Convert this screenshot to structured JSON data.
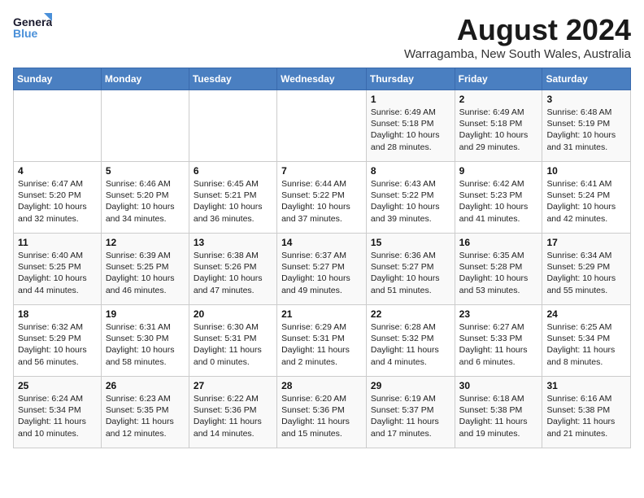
{
  "header": {
    "logo_line1": "General",
    "logo_line2": "Blue",
    "month_year": "August 2024",
    "location": "Warragamba, New South Wales, Australia"
  },
  "days_of_week": [
    "Sunday",
    "Monday",
    "Tuesday",
    "Wednesday",
    "Thursday",
    "Friday",
    "Saturday"
  ],
  "weeks": [
    [
      {
        "day": "",
        "info": ""
      },
      {
        "day": "",
        "info": ""
      },
      {
        "day": "",
        "info": ""
      },
      {
        "day": "",
        "info": ""
      },
      {
        "day": "1",
        "info": "Sunrise: 6:49 AM\nSunset: 5:18 PM\nDaylight: 10 hours\nand 28 minutes."
      },
      {
        "day": "2",
        "info": "Sunrise: 6:49 AM\nSunset: 5:18 PM\nDaylight: 10 hours\nand 29 minutes."
      },
      {
        "day": "3",
        "info": "Sunrise: 6:48 AM\nSunset: 5:19 PM\nDaylight: 10 hours\nand 31 minutes."
      }
    ],
    [
      {
        "day": "4",
        "info": "Sunrise: 6:47 AM\nSunset: 5:20 PM\nDaylight: 10 hours\nand 32 minutes."
      },
      {
        "day": "5",
        "info": "Sunrise: 6:46 AM\nSunset: 5:20 PM\nDaylight: 10 hours\nand 34 minutes."
      },
      {
        "day": "6",
        "info": "Sunrise: 6:45 AM\nSunset: 5:21 PM\nDaylight: 10 hours\nand 36 minutes."
      },
      {
        "day": "7",
        "info": "Sunrise: 6:44 AM\nSunset: 5:22 PM\nDaylight: 10 hours\nand 37 minutes."
      },
      {
        "day": "8",
        "info": "Sunrise: 6:43 AM\nSunset: 5:22 PM\nDaylight: 10 hours\nand 39 minutes."
      },
      {
        "day": "9",
        "info": "Sunrise: 6:42 AM\nSunset: 5:23 PM\nDaylight: 10 hours\nand 41 minutes."
      },
      {
        "day": "10",
        "info": "Sunrise: 6:41 AM\nSunset: 5:24 PM\nDaylight: 10 hours\nand 42 minutes."
      }
    ],
    [
      {
        "day": "11",
        "info": "Sunrise: 6:40 AM\nSunset: 5:25 PM\nDaylight: 10 hours\nand 44 minutes."
      },
      {
        "day": "12",
        "info": "Sunrise: 6:39 AM\nSunset: 5:25 PM\nDaylight: 10 hours\nand 46 minutes."
      },
      {
        "day": "13",
        "info": "Sunrise: 6:38 AM\nSunset: 5:26 PM\nDaylight: 10 hours\nand 47 minutes."
      },
      {
        "day": "14",
        "info": "Sunrise: 6:37 AM\nSunset: 5:27 PM\nDaylight: 10 hours\nand 49 minutes."
      },
      {
        "day": "15",
        "info": "Sunrise: 6:36 AM\nSunset: 5:27 PM\nDaylight: 10 hours\nand 51 minutes."
      },
      {
        "day": "16",
        "info": "Sunrise: 6:35 AM\nSunset: 5:28 PM\nDaylight: 10 hours\nand 53 minutes."
      },
      {
        "day": "17",
        "info": "Sunrise: 6:34 AM\nSunset: 5:29 PM\nDaylight: 10 hours\nand 55 minutes."
      }
    ],
    [
      {
        "day": "18",
        "info": "Sunrise: 6:32 AM\nSunset: 5:29 PM\nDaylight: 10 hours\nand 56 minutes."
      },
      {
        "day": "19",
        "info": "Sunrise: 6:31 AM\nSunset: 5:30 PM\nDaylight: 10 hours\nand 58 minutes."
      },
      {
        "day": "20",
        "info": "Sunrise: 6:30 AM\nSunset: 5:31 PM\nDaylight: 11 hours\nand 0 minutes."
      },
      {
        "day": "21",
        "info": "Sunrise: 6:29 AM\nSunset: 5:31 PM\nDaylight: 11 hours\nand 2 minutes."
      },
      {
        "day": "22",
        "info": "Sunrise: 6:28 AM\nSunset: 5:32 PM\nDaylight: 11 hours\nand 4 minutes."
      },
      {
        "day": "23",
        "info": "Sunrise: 6:27 AM\nSunset: 5:33 PM\nDaylight: 11 hours\nand 6 minutes."
      },
      {
        "day": "24",
        "info": "Sunrise: 6:25 AM\nSunset: 5:34 PM\nDaylight: 11 hours\nand 8 minutes."
      }
    ],
    [
      {
        "day": "25",
        "info": "Sunrise: 6:24 AM\nSunset: 5:34 PM\nDaylight: 11 hours\nand 10 minutes."
      },
      {
        "day": "26",
        "info": "Sunrise: 6:23 AM\nSunset: 5:35 PM\nDaylight: 11 hours\nand 12 minutes."
      },
      {
        "day": "27",
        "info": "Sunrise: 6:22 AM\nSunset: 5:36 PM\nDaylight: 11 hours\nand 14 minutes."
      },
      {
        "day": "28",
        "info": "Sunrise: 6:20 AM\nSunset: 5:36 PM\nDaylight: 11 hours\nand 15 minutes."
      },
      {
        "day": "29",
        "info": "Sunrise: 6:19 AM\nSunset: 5:37 PM\nDaylight: 11 hours\nand 17 minutes."
      },
      {
        "day": "30",
        "info": "Sunrise: 6:18 AM\nSunset: 5:38 PM\nDaylight: 11 hours\nand 19 minutes."
      },
      {
        "day": "31",
        "info": "Sunrise: 6:16 AM\nSunset: 5:38 PM\nDaylight: 11 hours\nand 21 minutes."
      }
    ]
  ]
}
